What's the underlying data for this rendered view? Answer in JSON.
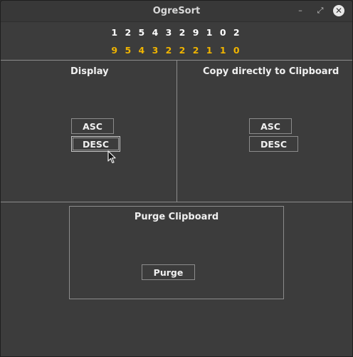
{
  "window": {
    "title": "OgreSort",
    "controls": {
      "minimize": "–",
      "maximize": "⤢",
      "close": "✕"
    }
  },
  "numbers": {
    "input": "1 2 5 4 3 2 9 1 0 2",
    "sorted": "9 5 4 3 2 2 2 1 1 0"
  },
  "display_panel": {
    "heading": "Display",
    "asc_label": "ASC",
    "desc_label": "DESC"
  },
  "clipboard_panel": {
    "heading": "Copy directly to Clipboard",
    "asc_label": "ASC",
    "desc_label": "DESC"
  },
  "purge_panel": {
    "heading": "Purge Clipboard",
    "purge_label": "Purge"
  },
  "colors": {
    "background": "#3c3c3c",
    "input_numbers": "#ffffff",
    "sorted_numbers": "#f0b400",
    "border": "#8c8c8c"
  }
}
